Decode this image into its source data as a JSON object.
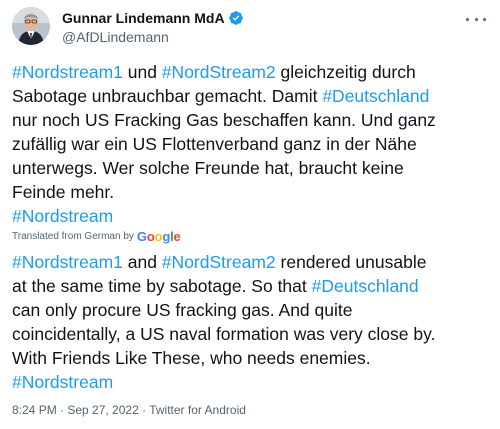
{
  "author": {
    "name": "Gunnar Lindemann MdA",
    "handle": "@AfDLindemann",
    "verified_color": "#1d9bf0"
  },
  "tweet": {
    "original_lines": [
      [
        {
          "text": "#Nordstream1",
          "tag": true
        },
        {
          "text": " und ",
          "tag": false
        },
        {
          "text": "#NordStream2",
          "tag": true
        },
        {
          "text": " gleichzeitig durch",
          "tag": false
        }
      ],
      [
        {
          "text": "Sabotage unbrauchbar gemacht. Damit ",
          "tag": false
        },
        {
          "text": "#Deutschland",
          "tag": true
        }
      ],
      [
        {
          "text": "nur noch US Fracking Gas beschaffen kann. Und ganz",
          "tag": false
        }
      ],
      [
        {
          "text": "zufällig war ein US Flottenverband ganz in der Nähe",
          "tag": false
        }
      ],
      [
        {
          "text": "unterwegs. Wer solche Freunde hat, braucht keine",
          "tag": false
        }
      ],
      [
        {
          "text": "Feinde mehr.",
          "tag": false
        }
      ],
      [
        {
          "text": "#Nordstream",
          "tag": true
        }
      ]
    ],
    "translated_label": "Translated from German by",
    "translator": "Google",
    "translation_lines": [
      [
        {
          "text": "#Nordstream1",
          "tag": true
        },
        {
          "text": " and ",
          "tag": false
        },
        {
          "text": "#NordStream2",
          "tag": true
        },
        {
          "text": " rendered unusable",
          "tag": false
        }
      ],
      [
        {
          "text": "at the same time by sabotage. So that ",
          "tag": false
        },
        {
          "text": "#Deutschland",
          "tag": true
        }
      ],
      [
        {
          "text": "can only procure US fracking gas. And quite",
          "tag": false
        }
      ],
      [
        {
          "text": "coincidentally, a US naval formation was very close by.",
          "tag": false
        }
      ],
      [
        {
          "text": "With Friends Like These, who needs enemies.",
          "tag": false
        }
      ],
      [
        {
          "text": "#Nordstream",
          "tag": true
        }
      ]
    ],
    "timestamp": "8:24 PM · Sep 27, 2022 · Twitter for Android",
    "link_color": "#1d9bf0"
  }
}
